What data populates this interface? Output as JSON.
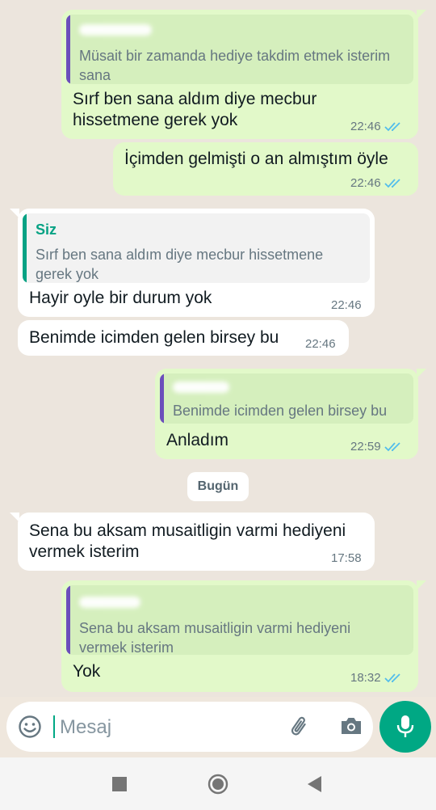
{
  "messages": [
    {
      "quote_text": "Müsait bir zamanda hediye takdim etmek isterim sana",
      "text": "Sırf ben sana aldım diye mecbur hissetmene gerek yok",
      "time": "22:46"
    },
    {
      "text": "İçimden gelmişti o an almıştım öyle",
      "time": "22:46"
    },
    {
      "quote_name": "Siz",
      "quote_text": "Sırf ben sana aldım diye mecbur hissetmene gerek yok",
      "text": "Hayir oyle bir durum yok",
      "time": "22:46"
    },
    {
      "text": "Benimde icimden gelen birsey bu",
      "time": "22:46"
    },
    {
      "quote_text": "Benimde icimden gelen birsey bu",
      "text": "Anladım",
      "time": "22:59"
    },
    {
      "text": "Sena bu aksam musaitligin varmi hediyeni vermek isterim",
      "time": "17:58"
    },
    {
      "quote_text": "Sena bu aksam musaitligin varmi hediyeni vermek isterim",
      "text": "Yok",
      "time": "18:32"
    }
  ],
  "date_divider": "Bugün",
  "composer": {
    "placeholder": "Mesaj"
  },
  "icons": {
    "emoji": "emoji-icon",
    "attach": "paperclip-icon",
    "camera": "camera-icon",
    "mic": "microphone-icon",
    "read_receipt": "double-check-icon"
  },
  "colors": {
    "outgoing_bubble": "#e2f9c9",
    "incoming_bubble": "#ffffff",
    "chat_background": "#ece5dd",
    "accent": "#00a884",
    "read_tick": "#53bdeb",
    "quote_bar_self": "#06a284",
    "quote_bar_other": "#6b4fbb"
  }
}
